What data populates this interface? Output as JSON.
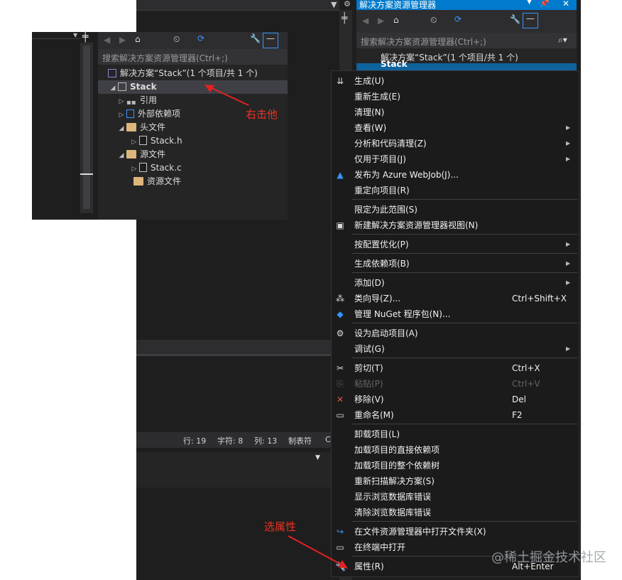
{
  "right_panel": {
    "title": "解决方案资源管理器",
    "search_placeholder": "搜索解决方案资源管理器(Ctrl+;)",
    "solution_row": "解决方案“Stack”(1 个项目/共 1 个)",
    "selected_row": "Stack"
  },
  "left_panel": {
    "search_placeholder": "搜索解决方案资源管理器(Ctrl+;)",
    "tree": [
      {
        "label": "解决方案“Stack”(1 个项目/共 1 个)"
      },
      {
        "label": "Stack"
      },
      {
        "label": "引用"
      },
      {
        "label": "外部依赖项"
      },
      {
        "label": "头文件"
      },
      {
        "label": "Stack.h"
      },
      {
        "label": "源文件"
      },
      {
        "label": "Stack.c"
      },
      {
        "label": "资源文件"
      }
    ]
  },
  "status_bar": {
    "line": "行: 19",
    "char": "字符: 8",
    "col": "列: 13",
    "tab": "制表符",
    "extra": "C"
  },
  "context_menu": {
    "items": [
      {
        "label": "生成(U)",
        "icon": "build-icon"
      },
      {
        "label": "重新生成(E)"
      },
      {
        "label": "清理(N)"
      },
      {
        "label": "查看(W)",
        "submenu": true
      },
      {
        "label": "分析和代码清理(Z)",
        "submenu": true
      },
      {
        "label": "仅用于项目(J)",
        "submenu": true
      },
      {
        "label": "发布为 Azure WebJob(J)...",
        "icon": "azure-icon"
      },
      {
        "label": "重定向项目(R)"
      },
      {
        "label": "限定为此范围(S)"
      },
      {
        "label": "新建解决方案资源管理器视图(N)",
        "icon": "new-view-icon"
      },
      {
        "label": "按配置优化(P)",
        "submenu": true
      },
      {
        "label": "生成依赖项(B)",
        "submenu": true
      },
      {
        "label": "添加(D)",
        "submenu": true
      },
      {
        "label": "类向导(Z)...",
        "shortcut": "Ctrl+Shift+X",
        "icon": "class-wizard-icon"
      },
      {
        "label": "管理 NuGet 程序包(N)...",
        "icon": "nuget-icon"
      },
      {
        "label": "设为启动项目(A)",
        "icon": "gear-icon"
      },
      {
        "label": "调试(G)",
        "submenu": true
      },
      {
        "label": "剪切(T)",
        "shortcut": "Ctrl+X",
        "icon": "scissors-icon"
      },
      {
        "label": "粘贴(P)",
        "shortcut": "Ctrl+V",
        "icon": "paste-icon",
        "disabled": true
      },
      {
        "label": "移除(V)",
        "shortcut": "Del",
        "icon": "remove-icon"
      },
      {
        "label": "重命名(M)",
        "shortcut": "F2",
        "icon": "rename-icon"
      },
      {
        "label": "卸载项目(L)"
      },
      {
        "label": "加载项目的直接依赖项"
      },
      {
        "label": "加载项目的整个依赖树"
      },
      {
        "label": "重新扫描解决方案(S)"
      },
      {
        "label": "显示浏览数据库错误"
      },
      {
        "label": "清除浏览数据库错误"
      },
      {
        "label": "在文件资源管理器中打开文件夹(X)",
        "icon": "open-folder-icon"
      },
      {
        "label": "在终端中打开",
        "icon": "terminal-icon"
      },
      {
        "label": "属性(R)",
        "shortcut": "Alt+Enter",
        "icon": "wrench-icon"
      }
    ]
  },
  "annotations": {
    "right_click": "右击他",
    "select_properties": "选属性"
  },
  "watermark": "@稀土掘金技术社区",
  "colors": {
    "accent": "#007acc",
    "annotation": "#e32222",
    "menu_bg": "#1b1b1c"
  }
}
